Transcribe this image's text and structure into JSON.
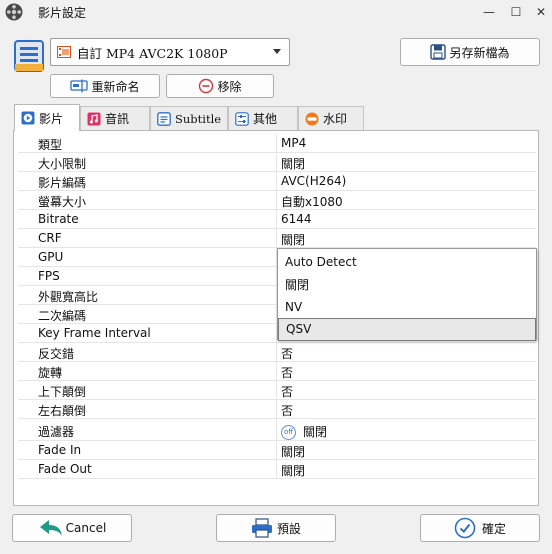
{
  "window": {
    "title": "影片設定",
    "minimize_glyph": "—",
    "maximize_glyph": "☐",
    "close_glyph": "✕"
  },
  "profile": {
    "selected": "自訂 MP4 AVC2K 1080P",
    "save_as_label": "另存新檔為",
    "rename_label": "重新命名",
    "remove_label": "移除"
  },
  "tabs": [
    {
      "label": "影片",
      "icon": "play-circle-icon"
    },
    {
      "label": "音訊",
      "icon": "music-note-icon"
    },
    {
      "label": "Subtitle",
      "icon": "subtitle-icon"
    },
    {
      "label": "其他",
      "icon": "sliders-icon"
    },
    {
      "label": "水印",
      "icon": "watermark-new-icon"
    }
  ],
  "properties": [
    {
      "key": "類型",
      "value": "MP4"
    },
    {
      "key": "大小限制",
      "value": "關閉"
    },
    {
      "key": "影片編碼",
      "value": "AVC(H264)"
    },
    {
      "key": "螢幕大小",
      "value": "自動x1080"
    },
    {
      "key": "Bitrate",
      "value": "6144"
    },
    {
      "key": "CRF",
      "value": "關閉"
    },
    {
      "key": "GPU",
      "value": ""
    },
    {
      "key": "FPS",
      "value": ""
    },
    {
      "key": "外觀寬高比",
      "value": ""
    },
    {
      "key": "二次編碼",
      "value": ""
    },
    {
      "key": "Key Frame Interval",
      "value": ""
    },
    {
      "key": "反交錯",
      "value": "否"
    },
    {
      "key": "旋轉",
      "value": "否"
    },
    {
      "key": "上下顛倒",
      "value": "否"
    },
    {
      "key": "左右顛倒",
      "value": "否"
    },
    {
      "key": "過濾器",
      "value": "關閉",
      "icon_text": "off"
    },
    {
      "key": "Fade In",
      "value": "關閉"
    },
    {
      "key": "Fade Out",
      "value": "關閉"
    }
  ],
  "gpu_dropdown": {
    "options": [
      "Auto Detect",
      "關閉",
      "NV",
      "QSV"
    ],
    "selected": "QSV"
  },
  "footer": {
    "cancel_label": "Cancel",
    "preset_label": "預設",
    "ok_label": "確定"
  },
  "colors": {
    "accent_blue": "#2b6fc8",
    "remove_red": "#d23b3b",
    "cancel_teal": "#1f9a86",
    "watermark_orange": "#f07a1a"
  }
}
